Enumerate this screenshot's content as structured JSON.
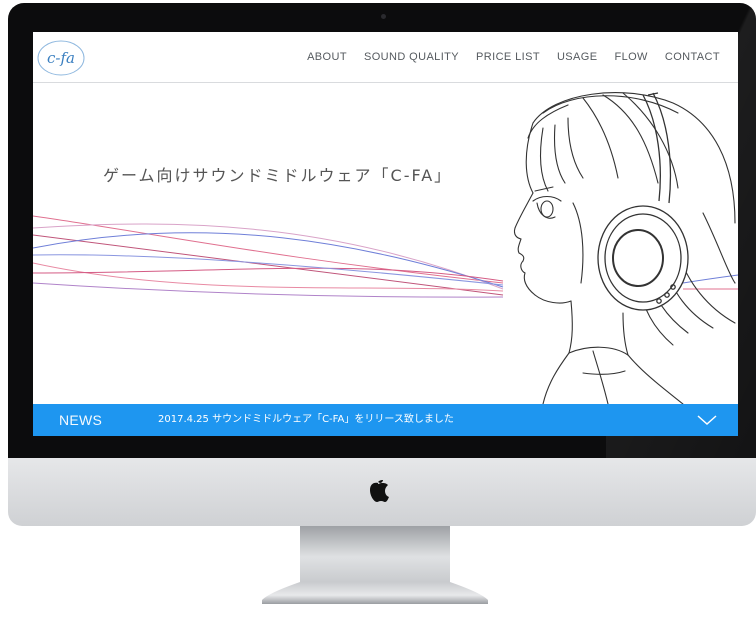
{
  "site": {
    "logo": "c-fa",
    "nav": [
      "ABOUT",
      "SOUND QUALITY",
      "PRICE LIST",
      "USAGE",
      "FLOW",
      "CONTACT"
    ],
    "hero_title": "ゲーム向けサウンドミドルウェア「C-FA」",
    "news": {
      "label": "NEWS",
      "text": "2017.4.25 サウンドミドルウェア「C-FA」をリリース致しました",
      "expand_icon": "chevron-down-icon"
    }
  },
  "device": {
    "brand_icon": "apple-logo-icon"
  },
  "colors": {
    "accent": "#1e96f0",
    "logo": "#3a7fc0",
    "line_red": "#e0708f",
    "line_blue": "#6f7fd8",
    "bezel": "#0c0c0d"
  }
}
